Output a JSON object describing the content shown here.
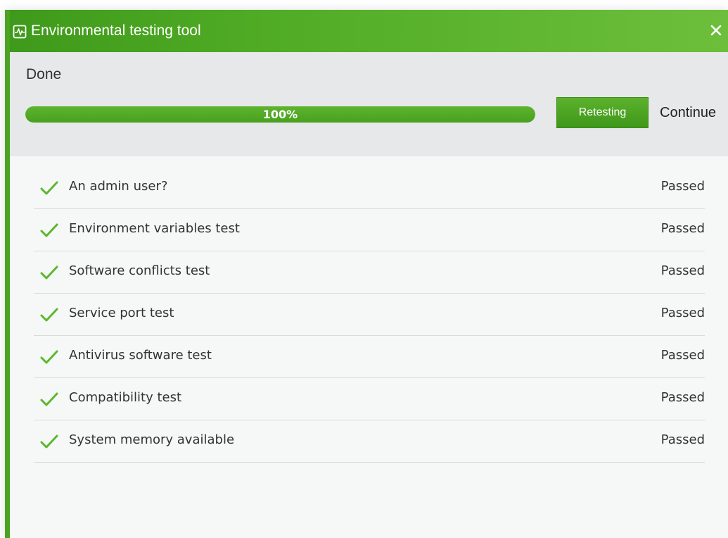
{
  "window": {
    "title": "Environmental testing tool",
    "app_icon": "monitor-pulse-icon",
    "close_icon": "close-icon",
    "close_symbol": "✕"
  },
  "header": {
    "status": "Done",
    "progress": {
      "value_percent": 100,
      "label": "100%"
    },
    "retest_label": "Retesting",
    "continue_label": "Continue"
  },
  "tests": [
    {
      "name": "An admin user?",
      "status": "Passed"
    },
    {
      "name": "Environment variables test",
      "status": "Passed"
    },
    {
      "name": "Software conflicts test",
      "status": "Passed"
    },
    {
      "name": "Service port test",
      "status": "Passed"
    },
    {
      "name": "Antivirus software test",
      "status": "Passed"
    },
    {
      "name": "Compatibility test",
      "status": "Passed"
    },
    {
      "name": "System memory available",
      "status": "Passed"
    }
  ],
  "colors": {
    "accent": "#4aa321",
    "check": "#5cb82e",
    "text": "#333333"
  }
}
